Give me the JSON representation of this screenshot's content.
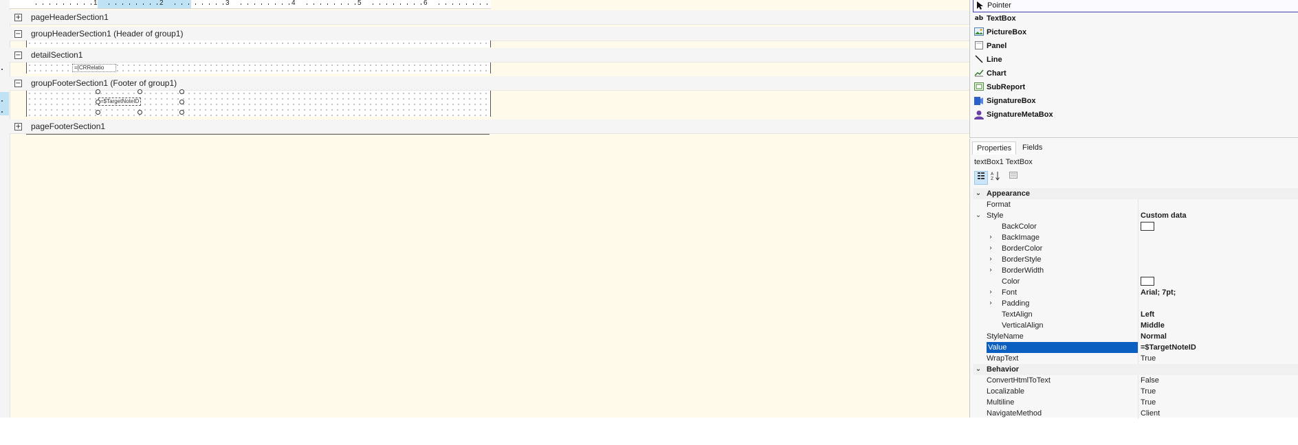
{
  "designer": {
    "ruler_numbers": [
      "1",
      "2",
      "3",
      "4",
      "5",
      "6"
    ],
    "bands": [
      {
        "label": "pageHeaderSection1",
        "toggle": "+"
      },
      {
        "label": "groupHeaderSection1 (Header of group1)",
        "toggle": "−"
      },
      {
        "label": "detailSection1",
        "toggle": "−"
      },
      {
        "label": "groupFooterSection1 (Footer of group1)",
        "toggle": "−"
      },
      {
        "label": "pageFooterSection1",
        "toggle": "+"
      }
    ],
    "detail_textbox": "=[CRRelatio",
    "footer_textbox": "=$TargetNoteID"
  },
  "toolbox": {
    "items": [
      {
        "label": "Pointer",
        "icon": "pointer-icon"
      },
      {
        "label": "TextBox",
        "icon": "textbox-icon"
      },
      {
        "label": "PictureBox",
        "icon": "picture-icon"
      },
      {
        "label": "Panel",
        "icon": "panel-icon"
      },
      {
        "label": "Line",
        "icon": "line-icon"
      },
      {
        "label": "Chart",
        "icon": "chart-icon"
      },
      {
        "label": "SubReport",
        "icon": "subreport-icon"
      },
      {
        "label": "SignatureBox",
        "icon": "signature-icon"
      },
      {
        "label": "SignatureMetaBox",
        "icon": "signature-meta-icon"
      }
    ]
  },
  "properties": {
    "tabs": [
      "Properties",
      "Fields"
    ],
    "object_title": "textBox1 TextBox",
    "rows": [
      {
        "kind": "cat",
        "name": "Appearance"
      },
      {
        "kind": "prop",
        "indent": 0,
        "name": "Format",
        "value": ""
      },
      {
        "kind": "prop",
        "indent": 0,
        "name": "Style",
        "value": "Custom data",
        "bold": true,
        "expander": "open"
      },
      {
        "kind": "prop",
        "indent": 1,
        "name": "BackColor",
        "value": "",
        "swatch": true
      },
      {
        "kind": "prop",
        "indent": 1,
        "name": "BackImage",
        "value": "",
        "expander": "closed"
      },
      {
        "kind": "prop",
        "indent": 1,
        "name": "BorderColor",
        "value": "",
        "expander": "closed"
      },
      {
        "kind": "prop",
        "indent": 1,
        "name": "BorderStyle",
        "value": "",
        "expander": "closed"
      },
      {
        "kind": "prop",
        "indent": 1,
        "name": "BorderWidth",
        "value": "",
        "expander": "closed"
      },
      {
        "kind": "prop",
        "indent": 1,
        "name": "Color",
        "value": "",
        "swatch": true
      },
      {
        "kind": "prop",
        "indent": 1,
        "name": "Font",
        "value": "Arial; 7pt;",
        "bold": true,
        "expander": "closed"
      },
      {
        "kind": "prop",
        "indent": 1,
        "name": "Padding",
        "value": "",
        "expander": "closed"
      },
      {
        "kind": "prop",
        "indent": 1,
        "name": "TextAlign",
        "value": "Left",
        "bold": true
      },
      {
        "kind": "prop",
        "indent": 1,
        "name": "VerticalAlign",
        "value": "Middle",
        "bold": true
      },
      {
        "kind": "prop",
        "indent": 0,
        "name": "StyleName",
        "value": "Normal",
        "bold": true
      },
      {
        "kind": "prop",
        "indent": 0,
        "name": "Value",
        "value": "=$TargetNoteID",
        "bold": true,
        "selected": true
      },
      {
        "kind": "prop",
        "indent": 0,
        "name": "WrapText",
        "value": "True"
      },
      {
        "kind": "cat",
        "name": "Behavior"
      },
      {
        "kind": "prop",
        "indent": 0,
        "name": "ConvertHtmlToText",
        "value": "False"
      },
      {
        "kind": "prop",
        "indent": 0,
        "name": "Localizable",
        "value": "True"
      },
      {
        "kind": "prop",
        "indent": 0,
        "name": "Multiline",
        "value": "True"
      },
      {
        "kind": "prop",
        "indent": 0,
        "name": "NavigateMethod",
        "value": "Client"
      }
    ]
  },
  "colors": {
    "canvas": "#fffaea",
    "selection": "#0a5fc1",
    "ruler_highlight": "#bfe3f5"
  }
}
